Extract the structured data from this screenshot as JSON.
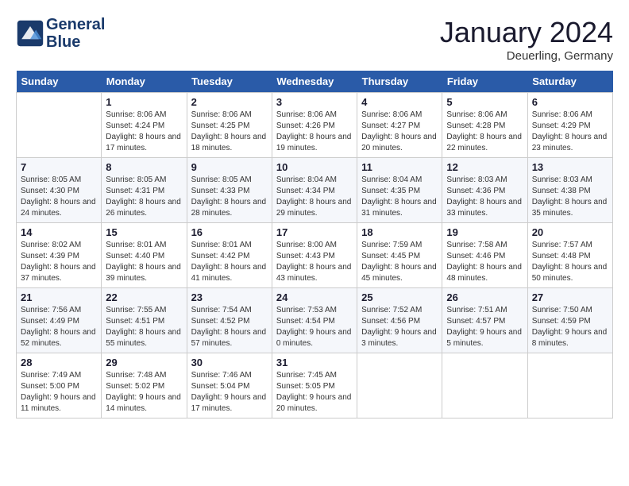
{
  "header": {
    "logo_line1": "General",
    "logo_line2": "Blue",
    "month_title": "January 2024",
    "location": "Deuerling, Germany"
  },
  "weekdays": [
    "Sunday",
    "Monday",
    "Tuesday",
    "Wednesday",
    "Thursday",
    "Friday",
    "Saturday"
  ],
  "weeks": [
    [
      {
        "day": "",
        "sunrise": "",
        "sunset": "",
        "daylight": ""
      },
      {
        "day": "1",
        "sunrise": "Sunrise: 8:06 AM",
        "sunset": "Sunset: 4:24 PM",
        "daylight": "Daylight: 8 hours and 17 minutes."
      },
      {
        "day": "2",
        "sunrise": "Sunrise: 8:06 AM",
        "sunset": "Sunset: 4:25 PM",
        "daylight": "Daylight: 8 hours and 18 minutes."
      },
      {
        "day": "3",
        "sunrise": "Sunrise: 8:06 AM",
        "sunset": "Sunset: 4:26 PM",
        "daylight": "Daylight: 8 hours and 19 minutes."
      },
      {
        "day": "4",
        "sunrise": "Sunrise: 8:06 AM",
        "sunset": "Sunset: 4:27 PM",
        "daylight": "Daylight: 8 hours and 20 minutes."
      },
      {
        "day": "5",
        "sunrise": "Sunrise: 8:06 AM",
        "sunset": "Sunset: 4:28 PM",
        "daylight": "Daylight: 8 hours and 22 minutes."
      },
      {
        "day": "6",
        "sunrise": "Sunrise: 8:06 AM",
        "sunset": "Sunset: 4:29 PM",
        "daylight": "Daylight: 8 hours and 23 minutes."
      }
    ],
    [
      {
        "day": "7",
        "sunrise": "Sunrise: 8:05 AM",
        "sunset": "Sunset: 4:30 PM",
        "daylight": "Daylight: 8 hours and 24 minutes."
      },
      {
        "day": "8",
        "sunrise": "Sunrise: 8:05 AM",
        "sunset": "Sunset: 4:31 PM",
        "daylight": "Daylight: 8 hours and 26 minutes."
      },
      {
        "day": "9",
        "sunrise": "Sunrise: 8:05 AM",
        "sunset": "Sunset: 4:33 PM",
        "daylight": "Daylight: 8 hours and 28 minutes."
      },
      {
        "day": "10",
        "sunrise": "Sunrise: 8:04 AM",
        "sunset": "Sunset: 4:34 PM",
        "daylight": "Daylight: 8 hours and 29 minutes."
      },
      {
        "day": "11",
        "sunrise": "Sunrise: 8:04 AM",
        "sunset": "Sunset: 4:35 PM",
        "daylight": "Daylight: 8 hours and 31 minutes."
      },
      {
        "day": "12",
        "sunrise": "Sunrise: 8:03 AM",
        "sunset": "Sunset: 4:36 PM",
        "daylight": "Daylight: 8 hours and 33 minutes."
      },
      {
        "day": "13",
        "sunrise": "Sunrise: 8:03 AM",
        "sunset": "Sunset: 4:38 PM",
        "daylight": "Daylight: 8 hours and 35 minutes."
      }
    ],
    [
      {
        "day": "14",
        "sunrise": "Sunrise: 8:02 AM",
        "sunset": "Sunset: 4:39 PM",
        "daylight": "Daylight: 8 hours and 37 minutes."
      },
      {
        "day": "15",
        "sunrise": "Sunrise: 8:01 AM",
        "sunset": "Sunset: 4:40 PM",
        "daylight": "Daylight: 8 hours and 39 minutes."
      },
      {
        "day": "16",
        "sunrise": "Sunrise: 8:01 AM",
        "sunset": "Sunset: 4:42 PM",
        "daylight": "Daylight: 8 hours and 41 minutes."
      },
      {
        "day": "17",
        "sunrise": "Sunrise: 8:00 AM",
        "sunset": "Sunset: 4:43 PM",
        "daylight": "Daylight: 8 hours and 43 minutes."
      },
      {
        "day": "18",
        "sunrise": "Sunrise: 7:59 AM",
        "sunset": "Sunset: 4:45 PM",
        "daylight": "Daylight: 8 hours and 45 minutes."
      },
      {
        "day": "19",
        "sunrise": "Sunrise: 7:58 AM",
        "sunset": "Sunset: 4:46 PM",
        "daylight": "Daylight: 8 hours and 48 minutes."
      },
      {
        "day": "20",
        "sunrise": "Sunrise: 7:57 AM",
        "sunset": "Sunset: 4:48 PM",
        "daylight": "Daylight: 8 hours and 50 minutes."
      }
    ],
    [
      {
        "day": "21",
        "sunrise": "Sunrise: 7:56 AM",
        "sunset": "Sunset: 4:49 PM",
        "daylight": "Daylight: 8 hours and 52 minutes."
      },
      {
        "day": "22",
        "sunrise": "Sunrise: 7:55 AM",
        "sunset": "Sunset: 4:51 PM",
        "daylight": "Daylight: 8 hours and 55 minutes."
      },
      {
        "day": "23",
        "sunrise": "Sunrise: 7:54 AM",
        "sunset": "Sunset: 4:52 PM",
        "daylight": "Daylight: 8 hours and 57 minutes."
      },
      {
        "day": "24",
        "sunrise": "Sunrise: 7:53 AM",
        "sunset": "Sunset: 4:54 PM",
        "daylight": "Daylight: 9 hours and 0 minutes."
      },
      {
        "day": "25",
        "sunrise": "Sunrise: 7:52 AM",
        "sunset": "Sunset: 4:56 PM",
        "daylight": "Daylight: 9 hours and 3 minutes."
      },
      {
        "day": "26",
        "sunrise": "Sunrise: 7:51 AM",
        "sunset": "Sunset: 4:57 PM",
        "daylight": "Daylight: 9 hours and 5 minutes."
      },
      {
        "day": "27",
        "sunrise": "Sunrise: 7:50 AM",
        "sunset": "Sunset: 4:59 PM",
        "daylight": "Daylight: 9 hours and 8 minutes."
      }
    ],
    [
      {
        "day": "28",
        "sunrise": "Sunrise: 7:49 AM",
        "sunset": "Sunset: 5:00 PM",
        "daylight": "Daylight: 9 hours and 11 minutes."
      },
      {
        "day": "29",
        "sunrise": "Sunrise: 7:48 AM",
        "sunset": "Sunset: 5:02 PM",
        "daylight": "Daylight: 9 hours and 14 minutes."
      },
      {
        "day": "30",
        "sunrise": "Sunrise: 7:46 AM",
        "sunset": "Sunset: 5:04 PM",
        "daylight": "Daylight: 9 hours and 17 minutes."
      },
      {
        "day": "31",
        "sunrise": "Sunrise: 7:45 AM",
        "sunset": "Sunset: 5:05 PM",
        "daylight": "Daylight: 9 hours and 20 minutes."
      },
      {
        "day": "",
        "sunrise": "",
        "sunset": "",
        "daylight": ""
      },
      {
        "day": "",
        "sunrise": "",
        "sunset": "",
        "daylight": ""
      },
      {
        "day": "",
        "sunrise": "",
        "sunset": "",
        "daylight": ""
      }
    ]
  ]
}
